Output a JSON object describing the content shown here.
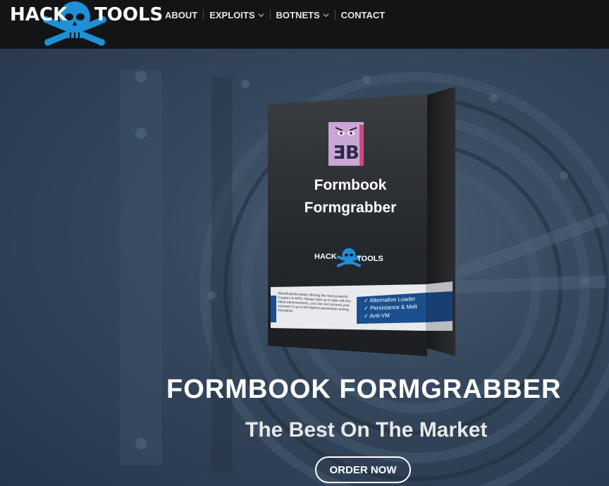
{
  "header": {
    "logo_left": "HACK",
    "logo_right": "TOOLS",
    "nav": [
      {
        "label": "ABOUT",
        "dropdown": false
      },
      {
        "label": "EXPLOITS",
        "dropdown": true
      },
      {
        "label": "BOTNETS",
        "dropdown": true
      },
      {
        "label": "CONTACT",
        "dropdown": false
      }
    ]
  },
  "product": {
    "box_title_line1": "Formbook",
    "box_title_line2": "Formgrabber",
    "box_logo_left": "HACK",
    "box_logo_right": "TOOLS",
    "box_description": "SilentExploits keeps offering the most powerful Crypters & RATs. Always kept up to date with the latest advancements, you can rest assured your software is up to the highest penetration testing standards.",
    "features": [
      "Alternative Loader",
      "Persistance & Melt",
      "Anti-VM"
    ]
  },
  "hero": {
    "title": "FORMBOOK FORMGRABBER",
    "subtitle": "The Best On The Market",
    "cta_label": "ORDER NOW"
  },
  "colors": {
    "header_bg": "#121416",
    "accent_blue": "#1f8fd6",
    "hero_bg": "#2f4156"
  }
}
